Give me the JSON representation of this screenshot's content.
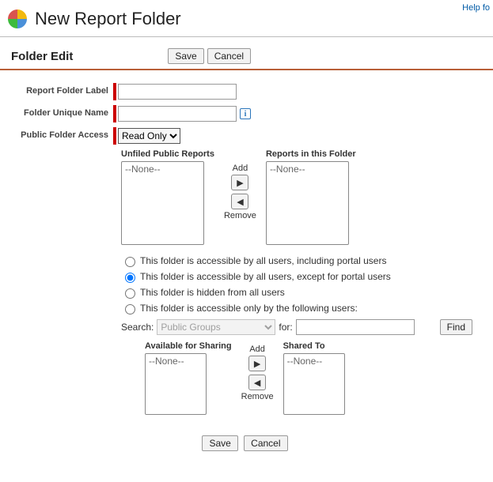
{
  "header": {
    "title": "New Report Folder",
    "help_link": "Help fo"
  },
  "section": {
    "title": "Folder Edit",
    "save_label": "Save",
    "cancel_label": "Cancel"
  },
  "form": {
    "label_report_folder": "Report Folder Label",
    "label_unique_name": "Folder Unique Name",
    "label_public_access": "Public Folder Access",
    "value_report_folder": "",
    "value_unique_name": "",
    "access_selected": "Read Only",
    "access_options": [
      "Read Only"
    ]
  },
  "dual1": {
    "left_heading": "Unfiled Public Reports",
    "right_heading": "Reports in this Folder",
    "left_option": "--None--",
    "right_option": "--None--",
    "add_label": "Add",
    "remove_label": "Remove"
  },
  "radios": {
    "opt1": "This folder is accessible by all users, including portal users",
    "opt2": "This folder is accessible by all users, except for portal users",
    "opt3": "This folder is hidden from all users",
    "opt4": "This folder is accessible only by the following users:"
  },
  "search": {
    "label": "Search:",
    "group_selected": "Public Groups",
    "for_label": "for:",
    "for_value": "",
    "find_label": "Find"
  },
  "dual2": {
    "left_heading": "Available for Sharing",
    "right_heading": "Shared To",
    "left_option": "--None--",
    "right_option": "--None--",
    "add_label": "Add",
    "remove_label": "Remove"
  },
  "footer": {
    "save_label": "Save",
    "cancel_label": "Cancel"
  }
}
